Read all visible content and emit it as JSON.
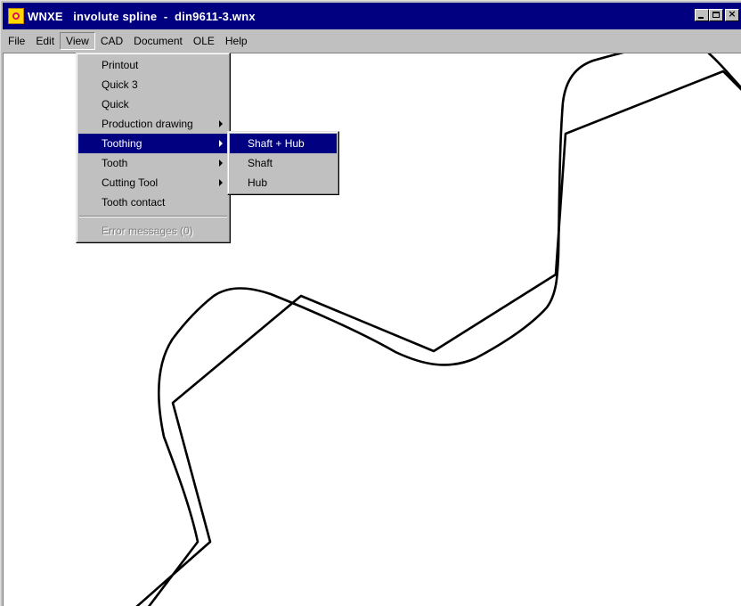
{
  "window": {
    "app_name": "WNXE",
    "title": "involute spline  -  din9611-3.wnx",
    "buttons": {
      "minimize": "minimize-icon",
      "maximize": "maximize-icon",
      "close_glyph": "×"
    }
  },
  "menubar": {
    "items": [
      {
        "label": "File"
      },
      {
        "label": "Edit"
      },
      {
        "label": "View",
        "open": true
      },
      {
        "label": "CAD"
      },
      {
        "label": "Document"
      },
      {
        "label": "OLE"
      },
      {
        "label": "Help"
      }
    ]
  },
  "view_menu": {
    "items": [
      {
        "label": "Printout",
        "has_submenu": false
      },
      {
        "label": "Quick 3",
        "has_submenu": false
      },
      {
        "label": "Quick",
        "has_submenu": false
      },
      {
        "label": "Production drawing",
        "has_submenu": true
      },
      {
        "label": "Toothing",
        "has_submenu": true,
        "highlighted": true
      },
      {
        "label": "Tooth",
        "has_submenu": true
      },
      {
        "label": "Cutting Tool",
        "has_submenu": true
      },
      {
        "label": "Tooth contact",
        "has_submenu": false
      }
    ],
    "disabled_item": {
      "label": "Error messages (0)"
    }
  },
  "toothing_submenu": {
    "items": [
      {
        "label": "Shaft + Hub",
        "highlighted": true
      },
      {
        "label": "Shaft"
      },
      {
        "label": "Hub"
      }
    ]
  },
  "colors": {
    "titlebar": "#000080",
    "highlight": "#000080",
    "face": "#c0c0c0",
    "canvas": "#ffffff",
    "drawing": "#000000"
  }
}
